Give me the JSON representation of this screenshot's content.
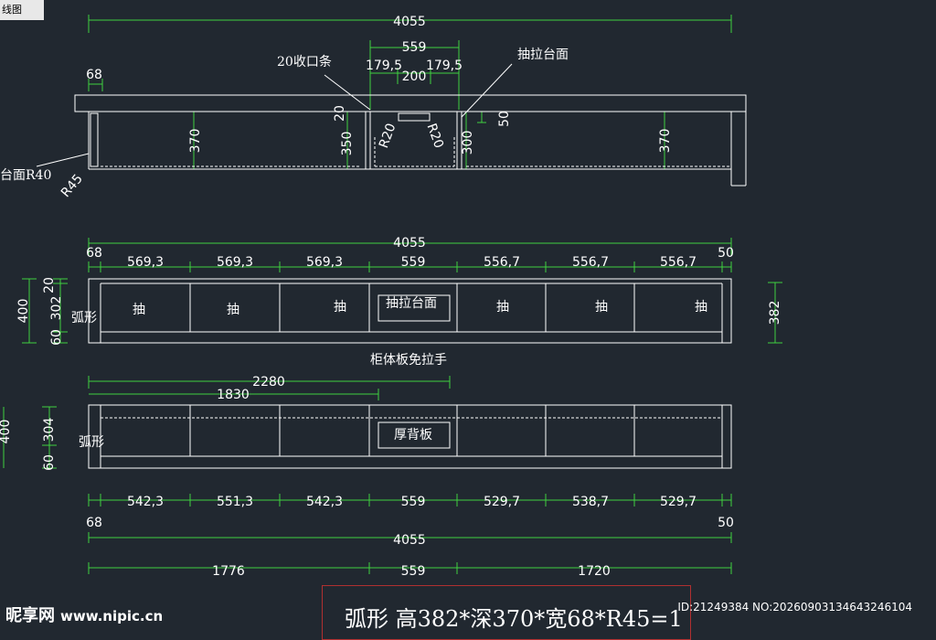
{
  "window_tab": "线图",
  "elevation": {
    "total": "4055",
    "mid_width": "559",
    "mid_left": "179,5",
    "mid_center": "200",
    "mid_right": "179,5",
    "end_left": "68",
    "h_left": "370",
    "h_mid": "350",
    "h_strip": "20",
    "h_drawer": "300",
    "h_right": "370",
    "d50": "50",
    "r_left": "R20",
    "r_right": "R20",
    "r45": "R45",
    "top_r40": "台面R40",
    "label_strip": "20收口条",
    "label_pull": "抽拉台面"
  },
  "front": {
    "total": "4055",
    "end_left": "68",
    "end_right": "50",
    "widths": [
      "569,3",
      "569,3",
      "569,3",
      "559",
      "556,7",
      "556,7",
      "556,7"
    ],
    "h_total": "400",
    "h_top": "20",
    "h_mid": "302",
    "h_bot": "60",
    "h_right": "382",
    "arc": "弧形",
    "drawer_label": "抽",
    "pull_label": "抽拉台面",
    "caption": "柜体板免拉手"
  },
  "back": {
    "dim_2280": "2280",
    "dim_1830": "1830",
    "h_mid": "304",
    "h_bot": "60",
    "h_total": "400",
    "arc": "弧形",
    "back_label": "厚背板",
    "widths": [
      "542,3",
      "551,3",
      "542,3",
      "559",
      "529,7",
      "538,7",
      "529,7"
    ],
    "end_left": "68",
    "end_right": "50",
    "total": "4055",
    "bottom": [
      "1776",
      "559",
      "1720"
    ]
  },
  "note": "弧形  高382*深370*宽68*R45=1",
  "watermark": {
    "brand": "昵享网",
    "site": "www.nipic.cn",
    "id": "ID:21249384 NO:20260903134643246104"
  }
}
